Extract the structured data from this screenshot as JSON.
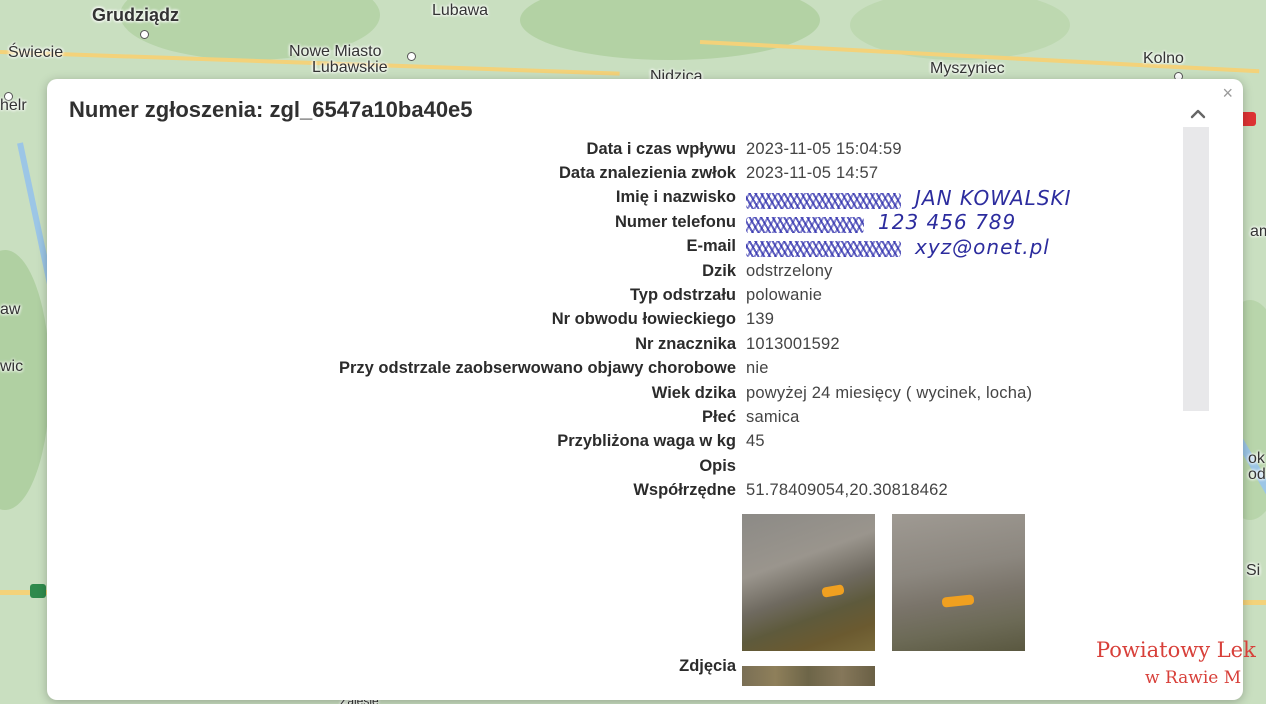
{
  "map": {
    "places": [
      "Grudziądz",
      "Lubawa",
      "Świecie",
      "Nowe Miasto",
      "Lubawskie",
      "Nidzica",
      "Myszyniec",
      "Kolno",
      "helr",
      "aw",
      "wic",
      "ok",
      "od",
      "Si",
      "am",
      "Zalesie"
    ]
  },
  "modal": {
    "close_glyph": "×",
    "title": "Numer zgłoszenia: zgl_6547a10ba40e5",
    "fields": [
      {
        "label": "Data i czas wpływu",
        "value": "2023-11-05 15:04:59"
      },
      {
        "label": "Data znalezienia zwłok",
        "value": "2023-11-05 14:57"
      },
      {
        "label": "Imię i nazwisko",
        "value": "",
        "handwritten": "JAN KOWALSKI"
      },
      {
        "label": "Numer telefonu",
        "value": "",
        "handwritten": "123 456 789"
      },
      {
        "label": "E-mail",
        "value": "",
        "handwritten": "xyz@onet.pl"
      },
      {
        "label": "Dzik",
        "value": "odstrzelony"
      },
      {
        "label": "Typ odstrzału",
        "value": "polowanie"
      },
      {
        "label": "Nr obwodu łowieckiego",
        "value": "139"
      },
      {
        "label": "Nr znacznika",
        "value": "1013001592"
      },
      {
        "label": "Przy odstrzale zaobserwowano objawy chorobowe",
        "value": "nie"
      },
      {
        "label": "Wiek dzika",
        "value": "powyżej 24 miesięcy ( wycinek, locha)"
      },
      {
        "label": "Płeć",
        "value": "samica"
      },
      {
        "label": "Przybliżona waga w kg",
        "value": "45"
      },
      {
        "label": "Opis",
        "value": ""
      },
      {
        "label": "Współrzędne",
        "value": "51.78409054,20.30818462"
      }
    ],
    "photos_label": "Zdjęcia"
  },
  "stamp": {
    "line1": "Powiatowy Lek",
    "line2": "w Rawie M"
  }
}
